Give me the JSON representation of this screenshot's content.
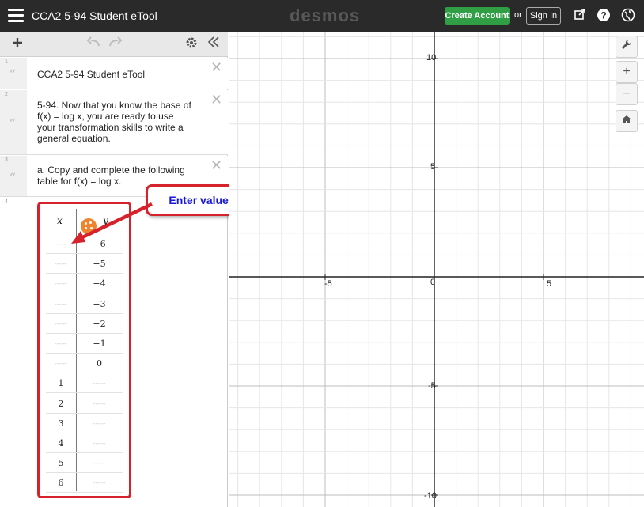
{
  "topbar": {
    "title": "CCA2 5-94 Student eTool",
    "brand": "desmos",
    "create_account": "Create Account",
    "or": "or",
    "sign_in": "Sign In"
  },
  "expressions": [
    {
      "num": "1",
      "text": "CCA2 5-94 Student eTool"
    },
    {
      "num": "2",
      "text": "5-94. Now that you know the base of f(x) = log x, you are ready to use your transformation skills to write a general equation."
    },
    {
      "num": "3",
      "text": "a. Copy and complete the following table for f(x) = log x."
    },
    {
      "num": "4"
    }
  ],
  "table": {
    "header_x": "x",
    "header_y": "y",
    "rows": [
      {
        "x": "",
        "y": "−6"
      },
      {
        "x": "",
        "y": "−5"
      },
      {
        "x": "",
        "y": "−4"
      },
      {
        "x": "",
        "y": "−3"
      },
      {
        "x": "",
        "y": "−2"
      },
      {
        "x": "",
        "y": "−1"
      },
      {
        "x": "",
        "y": "0"
      },
      {
        "x": "1",
        "y": ""
      },
      {
        "x": "2",
        "y": ""
      },
      {
        "x": "3",
        "y": ""
      },
      {
        "x": "4",
        "y": ""
      },
      {
        "x": "5",
        "y": ""
      },
      {
        "x": "6",
        "y": ""
      }
    ],
    "dot_color": "#f0842c"
  },
  "callout": {
    "text": "Enter values",
    "border_color": "#d6222a",
    "text_color": "#1818d8"
  },
  "graph": {
    "x_ticks": [
      "-5",
      "0",
      "5"
    ],
    "y_ticks": [
      "10",
      "5",
      "-5",
      "-10"
    ]
  }
}
